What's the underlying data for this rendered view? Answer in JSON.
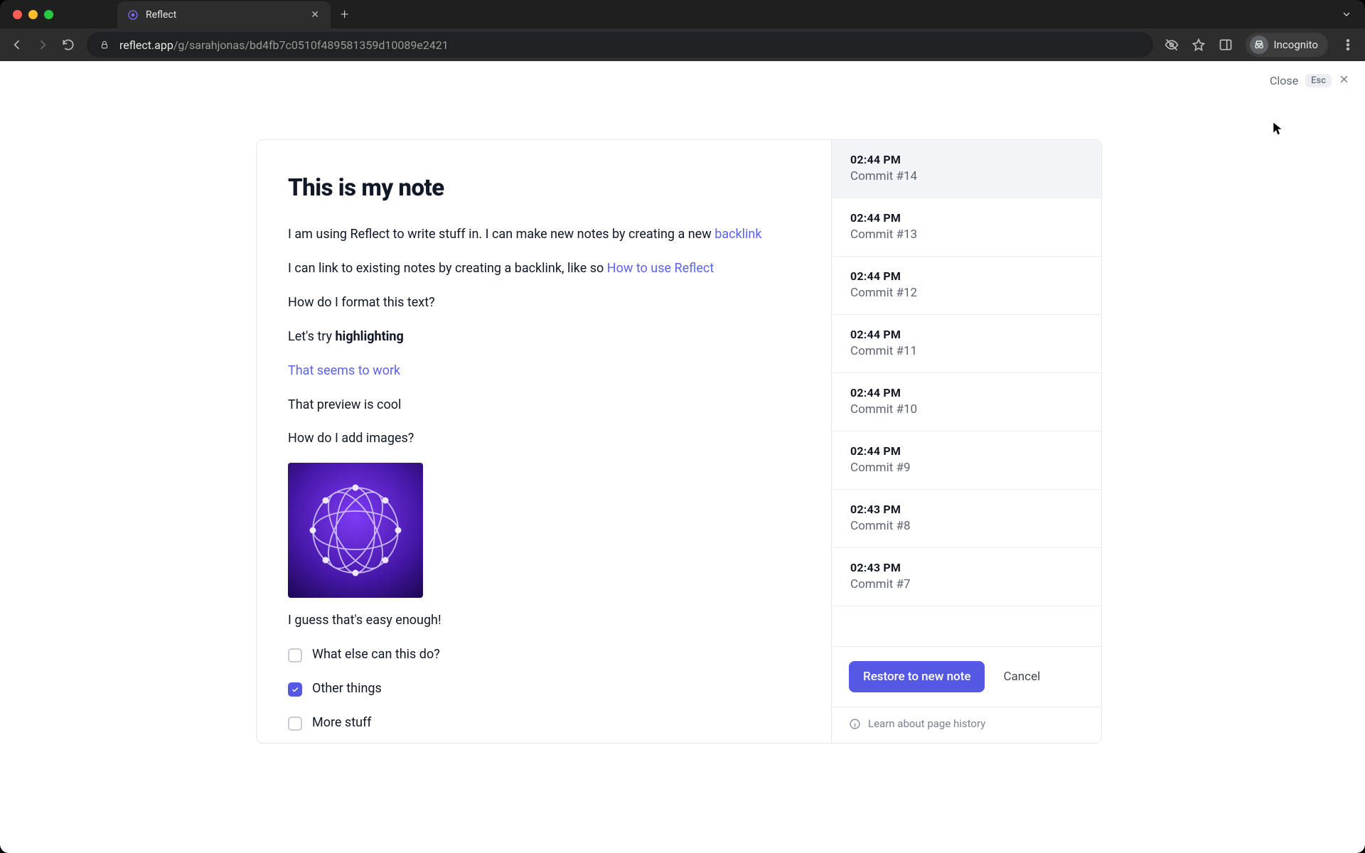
{
  "tab": {
    "title": "Reflect"
  },
  "url": {
    "host": "reflect.app",
    "path": "/g/sarahjonas/bd4fb7c0510f489581359d10089e2421"
  },
  "incognito_label": "Incognito",
  "close": {
    "label": "Close",
    "esc": "Esc"
  },
  "note": {
    "title": "This is my note",
    "p1a": "I am using Reflect to write stuff in. I can make new notes by creating a new ",
    "p1_link": "backlink",
    "p2a": "I can link to existing notes by creating a backlink, like so ",
    "p2_link": "How to use Reflect",
    "p3": "How do I format this text?",
    "p4a": "Let's try ",
    "p4b": "highlighting",
    "p5_link": "That seems to work",
    "p6": "That preview is cool",
    "p7": "How do I add images?",
    "p8": "I guess that's easy enough!"
  },
  "checks": [
    {
      "label": "What else can this do?",
      "checked": false
    },
    {
      "label": "Other things",
      "checked": true
    },
    {
      "label": "More stuff",
      "checked": false
    }
  ],
  "history": [
    {
      "time": "02:44 PM",
      "label": "Commit #14",
      "selected": true
    },
    {
      "time": "02:44 PM",
      "label": "Commit #13",
      "selected": false
    },
    {
      "time": "02:44 PM",
      "label": "Commit #12",
      "selected": false
    },
    {
      "time": "02:44 PM",
      "label": "Commit #11",
      "selected": false
    },
    {
      "time": "02:44 PM",
      "label": "Commit #10",
      "selected": false
    },
    {
      "time": "02:44 PM",
      "label": "Commit #9",
      "selected": false
    },
    {
      "time": "02:43 PM",
      "label": "Commit #8",
      "selected": false
    },
    {
      "time": "02:43 PM",
      "label": "Commit #7",
      "selected": false
    }
  ],
  "actions": {
    "restore": "Restore to new note",
    "cancel": "Cancel"
  },
  "learn_label": "Learn about page history"
}
